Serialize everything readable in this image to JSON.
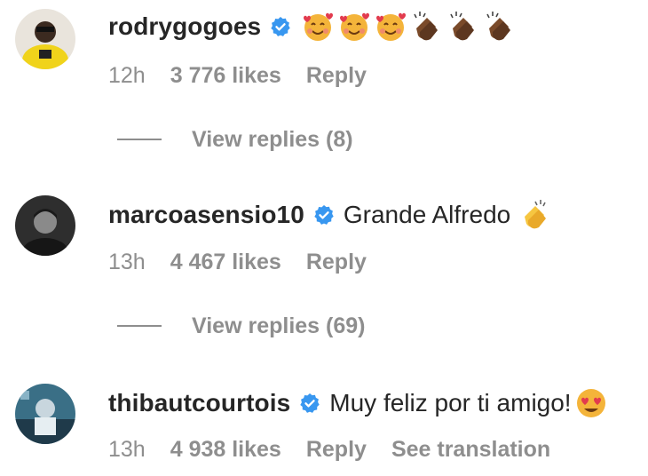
{
  "colors": {
    "verified": "#3897f0",
    "meta": "#8e8e8e",
    "text": "#262626"
  },
  "comments": [
    {
      "username": "rodrygogoes",
      "verified_icon": "verified-badge-icon",
      "text": "",
      "emojis": [
        "smiling-face-with-hearts",
        "smiling-face-with-hearts",
        "smiling-face-with-hearts",
        "clapping-hands-dark",
        "clapping-hands-dark",
        "clapping-hands-dark"
      ],
      "time": "12h",
      "likes": "3 776 likes",
      "reply_label": "Reply",
      "view_replies": "View replies (8)"
    },
    {
      "username": "marcoasensio10",
      "verified_icon": "verified-badge-icon",
      "text": "Grande Alfredo",
      "emojis": [
        "clapping-hands-yellow"
      ],
      "time": "13h",
      "likes": "4 467 likes",
      "reply_label": "Reply",
      "view_replies": "View replies (69)"
    },
    {
      "username": "thibautcourtois",
      "verified_icon": "verified-badge-icon",
      "text": "Muy feliz por ti amigo!",
      "emojis": [
        "heart-eyes-face"
      ],
      "time": "13h",
      "likes": "4 938 likes",
      "reply_label": "Reply",
      "see_translation": "See translation"
    }
  ]
}
